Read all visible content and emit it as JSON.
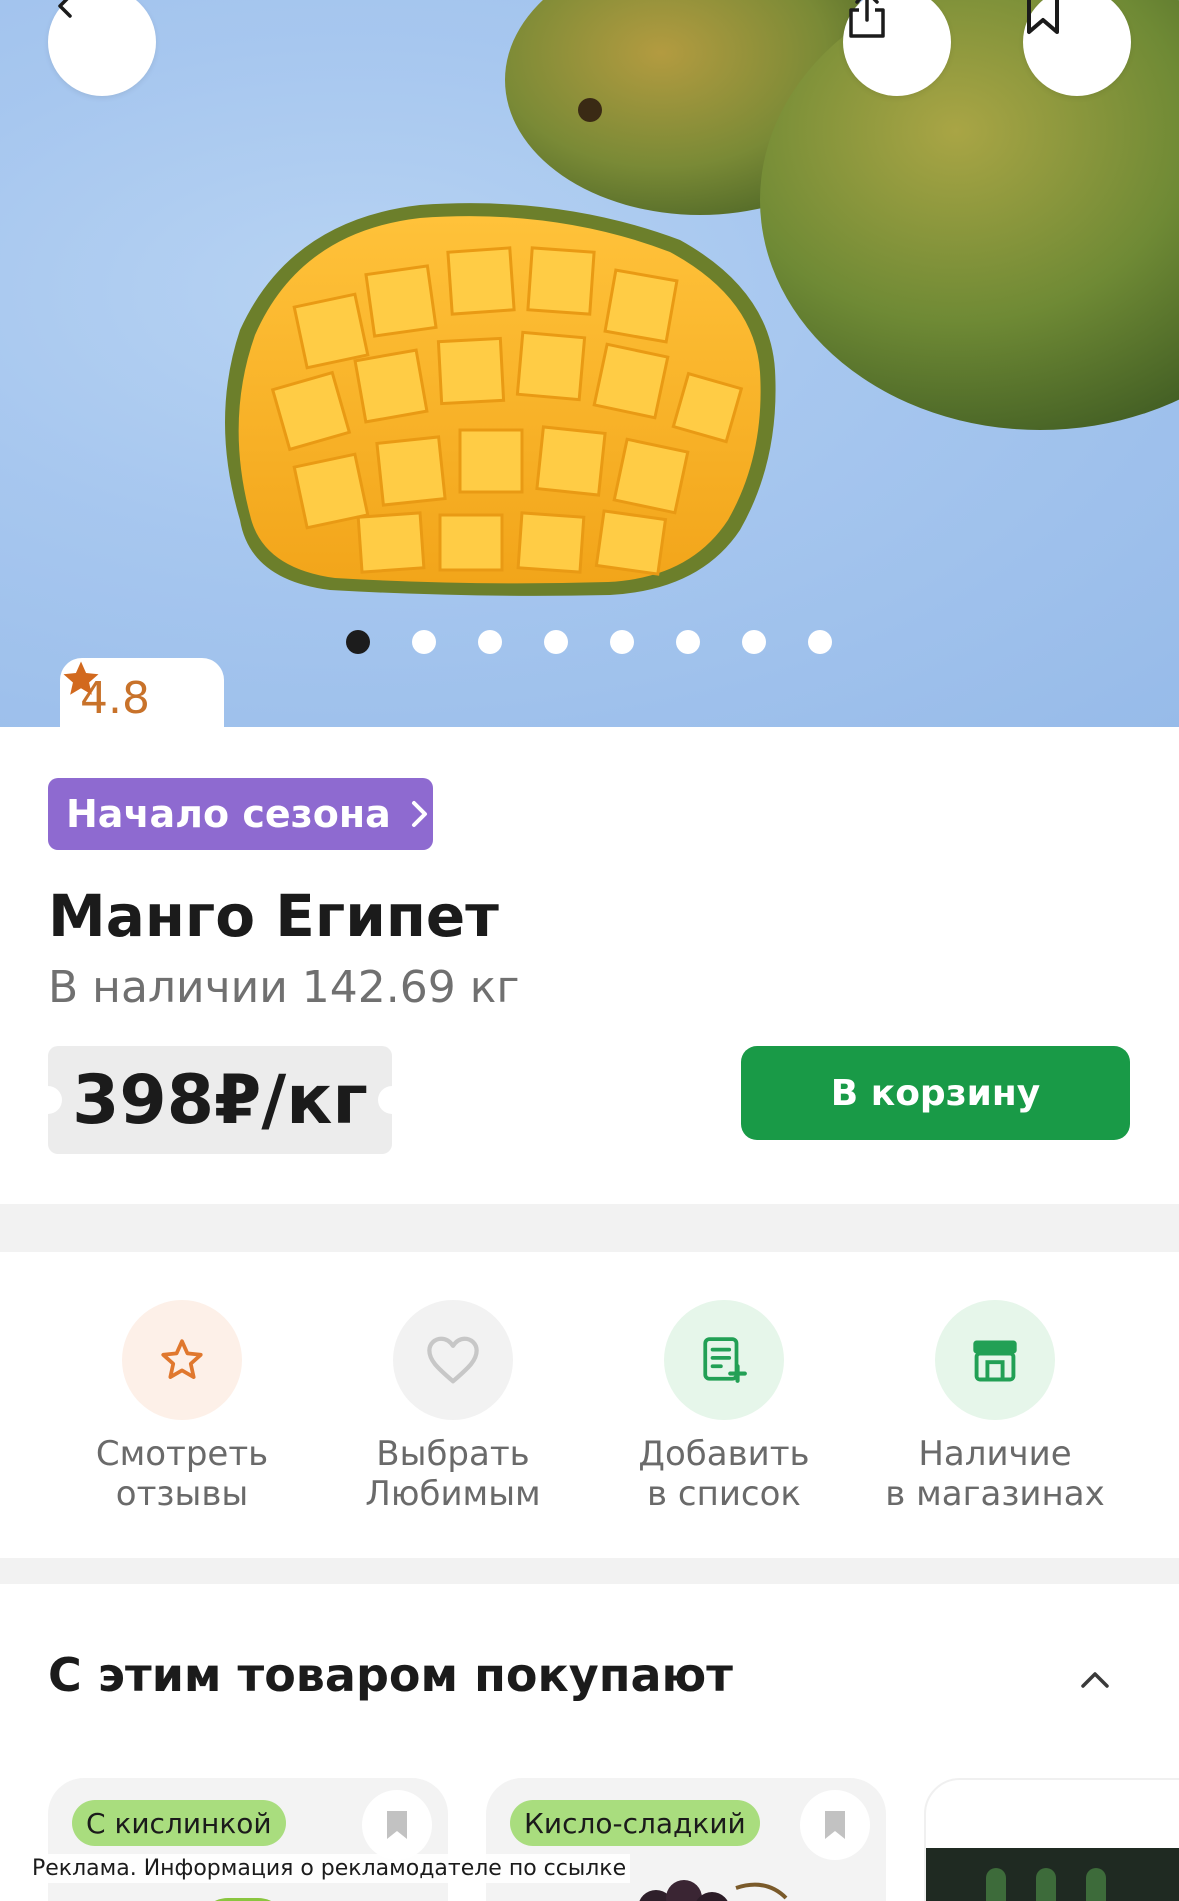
{
  "hero": {
    "slides_count": 8,
    "active_slide": 1,
    "rating": "4.8"
  },
  "product": {
    "badge": "Начало сезона",
    "title": "Манго Египет",
    "stock": "В наличии 142.69 кг",
    "price": "398₽/кг",
    "cart_button": "В корзину"
  },
  "actions": [
    {
      "line1": "Смотреть",
      "line2": "отзывы",
      "icon": "star-outline-icon",
      "bg": "#fdf0e8",
      "color": "#e0782e"
    },
    {
      "line1": "Выбрать",
      "line2": "Любимым",
      "icon": "heart-outline-icon",
      "bg": "#f2f2f2",
      "color": "#c7c7c7"
    },
    {
      "line1": "Добавить",
      "line2": "в список",
      "icon": "list-add-icon",
      "bg": "#e6f6ea",
      "color": "#22a055"
    },
    {
      "line1": "Наличие",
      "line2": "в магазинах",
      "icon": "store-icon",
      "bg": "#e6f6ea",
      "color": "#22a055"
    }
  ],
  "recommendations": {
    "title": "С этим товаром покупают",
    "cards": [
      {
        "tag": "С кислинкой"
      },
      {
        "tag": "Кисло-сладкий"
      }
    ]
  },
  "ad_note": "Реклама. Информация о рекламодателе по ссылке",
  "colors": {
    "accent_green": "#199a47",
    "badge_purple": "#8e6ad0",
    "rating_orange": "#c8722a",
    "hero_blue": "#a7c7ef"
  }
}
